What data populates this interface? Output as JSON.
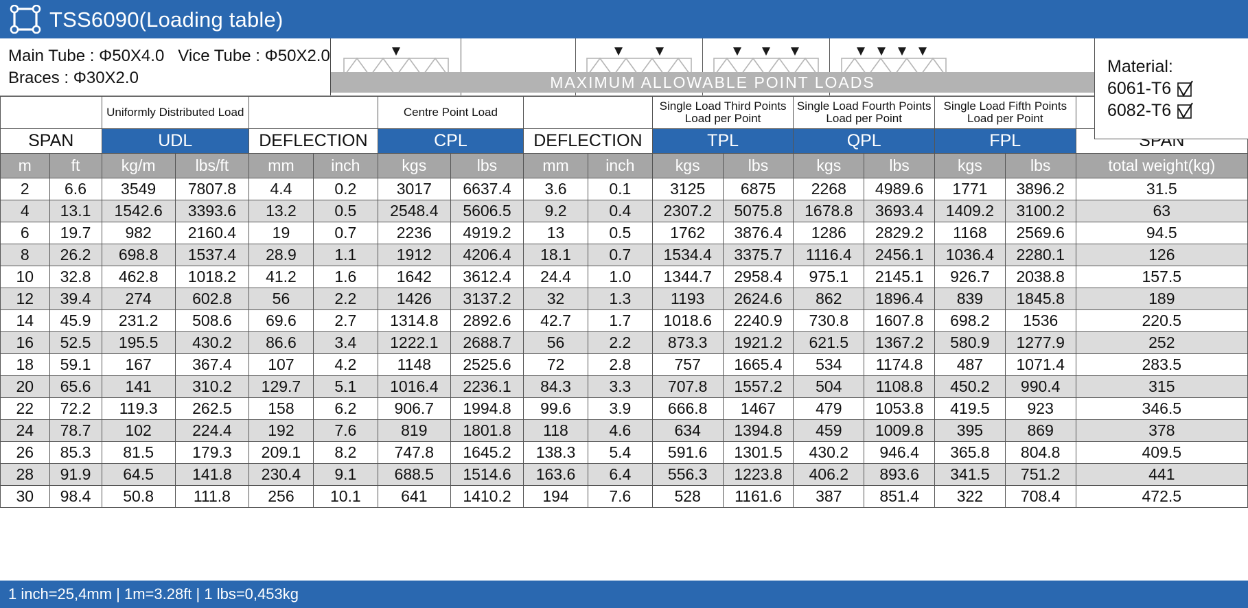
{
  "title": "TSS6090(Loading table)",
  "spec": {
    "line1_main": "Main Tube : Φ50X4.0",
    "line1_vice": "Vice Tube : Φ50X2.0",
    "line2": "Braces : Φ30X2.0"
  },
  "material": {
    "label": "Material:",
    "option1": "6061-T6",
    "option2": "6082-T6"
  },
  "max_strip": "MAXIMUM ALLOWABLE POINT LOADS",
  "group_headers": {
    "span_left": "SPAN",
    "udl_desc": "Uniformly Distributed Load",
    "deflection1": "",
    "cpl_desc": "Centre Point Load",
    "deflection2": "",
    "tpl_desc": "Single Load Third Points Load per Point",
    "qpl_desc": "Single Load Fourth Points Load per Point",
    "fpl_desc": "Single Load Fifth Points Load per Point",
    "span_right": ""
  },
  "abbrev_row": {
    "span": "SPAN",
    "udl": "UDL",
    "deflection1": "DEFLECTION",
    "cpl": "CPL",
    "deflection2": "DEFLECTION",
    "tpl": "TPL",
    "qpl": "QPL",
    "fpl": "FPL",
    "span_right": "SPAN"
  },
  "units_row": [
    "m",
    "ft",
    "kg/m",
    "lbs/ft",
    "mm",
    "inch",
    "kgs",
    "lbs",
    "mm",
    "inch",
    "kgs",
    "lbs",
    "kgs",
    "lbs",
    "kgs",
    "lbs",
    "total weight(kg)"
  ],
  "footer": "1 inch=25,4mm  |  1m=3.28ft  |  1 lbs=0,453kg",
  "colors": {
    "accent_blue": "#2a68b0",
    "strip_gray": "#b3b3b3",
    "unit_gray": "#a6a6a6",
    "row_alt": "#dcdcdc"
  },
  "chart_data": {
    "type": "table",
    "title": "TSS6090 Loading table",
    "columns": [
      "SPAN m",
      "SPAN ft",
      "UDL kg/m",
      "UDL lbs/ft",
      "DEFLECTION mm",
      "DEFLECTION inch",
      "CPL kgs",
      "CPL lbs",
      "DEFLECTION mm",
      "DEFLECTION inch",
      "TPL kgs",
      "TPL lbs",
      "QPL kgs",
      "QPL lbs",
      "FPL kgs",
      "FPL lbs",
      "total weight(kg)"
    ],
    "rows": [
      [
        "2",
        "6.6",
        "3549",
        "7807.8",
        "4.4",
        "0.2",
        "3017",
        "6637.4",
        "3.6",
        "0.1",
        "3125",
        "6875",
        "2268",
        "4989.6",
        "1771",
        "3896.2",
        "31.5"
      ],
      [
        "4",
        "13.1",
        "1542.6",
        "3393.6",
        "13.2",
        "0.5",
        "2548.4",
        "5606.5",
        "9.2",
        "0.4",
        "2307.2",
        "5075.8",
        "1678.8",
        "3693.4",
        "1409.2",
        "3100.2",
        "63"
      ],
      [
        "6",
        "19.7",
        "982",
        "2160.4",
        "19",
        "0.7",
        "2236",
        "4919.2",
        "13",
        "0.5",
        "1762",
        "3876.4",
        "1286",
        "2829.2",
        "1168",
        "2569.6",
        "94.5"
      ],
      [
        "8",
        "26.2",
        "698.8",
        "1537.4",
        "28.9",
        "1.1",
        "1912",
        "4206.4",
        "18.1",
        "0.7",
        "1534.4",
        "3375.7",
        "1116.4",
        "2456.1",
        "1036.4",
        "2280.1",
        "126"
      ],
      [
        "10",
        "32.8",
        "462.8",
        "1018.2",
        "41.2",
        "1.6",
        "1642",
        "3612.4",
        "24.4",
        "1.0",
        "1344.7",
        "2958.4",
        "975.1",
        "2145.1",
        "926.7",
        "2038.8",
        "157.5"
      ],
      [
        "12",
        "39.4",
        "274",
        "602.8",
        "56",
        "2.2",
        "1426",
        "3137.2",
        "32",
        "1.3",
        "1193",
        "2624.6",
        "862",
        "1896.4",
        "839",
        "1845.8",
        "189"
      ],
      [
        "14",
        "45.9",
        "231.2",
        "508.6",
        "69.6",
        "2.7",
        "1314.8",
        "2892.6",
        "42.7",
        "1.7",
        "1018.6",
        "2240.9",
        "730.8",
        "1607.8",
        "698.2",
        "1536",
        "220.5"
      ],
      [
        "16",
        "52.5",
        "195.5",
        "430.2",
        "86.6",
        "3.4",
        "1222.1",
        "2688.7",
        "56",
        "2.2",
        "873.3",
        "1921.2",
        "621.5",
        "1367.2",
        "580.9",
        "1277.9",
        "252"
      ],
      [
        "18",
        "59.1",
        "167",
        "367.4",
        "107",
        "4.2",
        "1148",
        "2525.6",
        "72",
        "2.8",
        "757",
        "1665.4",
        "534",
        "1174.8",
        "487",
        "1071.4",
        "283.5"
      ],
      [
        "20",
        "65.6",
        "141",
        "310.2",
        "129.7",
        "5.1",
        "1016.4",
        "2236.1",
        "84.3",
        "3.3",
        "707.8",
        "1557.2",
        "504",
        "1108.8",
        "450.2",
        "990.4",
        "315"
      ],
      [
        "22",
        "72.2",
        "119.3",
        "262.5",
        "158",
        "6.2",
        "906.7",
        "1994.8",
        "99.6",
        "3.9",
        "666.8",
        "1467",
        "479",
        "1053.8",
        "419.5",
        "923",
        "346.5"
      ],
      [
        "24",
        "78.7",
        "102",
        "224.4",
        "192",
        "7.6",
        "819",
        "1801.8",
        "118",
        "4.6",
        "634",
        "1394.8",
        "459",
        "1009.8",
        "395",
        "869",
        "378"
      ],
      [
        "26",
        "85.3",
        "81.5",
        "179.3",
        "209.1",
        "8.2",
        "747.8",
        "1645.2",
        "138.3",
        "5.4",
        "591.6",
        "1301.5",
        "430.2",
        "946.4",
        "365.8",
        "804.8",
        "409.5"
      ],
      [
        "28",
        "91.9",
        "64.5",
        "141.8",
        "230.4",
        "9.1",
        "688.5",
        "1514.6",
        "163.6",
        "6.4",
        "556.3",
        "1223.8",
        "406.2",
        "893.6",
        "341.5",
        "751.2",
        "441"
      ],
      [
        "30",
        "98.4",
        "50.8",
        "111.8",
        "256",
        "10.1",
        "641",
        "1410.2",
        "194",
        "7.6",
        "528",
        "1161.6",
        "387",
        "851.4",
        "322",
        "708.4",
        "472.5"
      ]
    ]
  }
}
